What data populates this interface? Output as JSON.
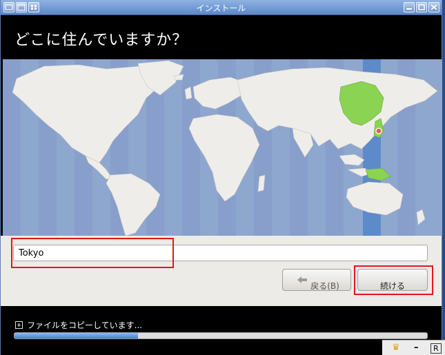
{
  "window": {
    "title": "インストール"
  },
  "header": {
    "question": "どこに住んでいますか？"
  },
  "timezone": {
    "selected_city": "Tokyo"
  },
  "buttons": {
    "back_label": "戻る(B)",
    "next_label": "続ける"
  },
  "footer": {
    "status_text": "ファイルをコピーしています...",
    "progress_percent": 30
  },
  "tray": {
    "items": [
      "crown-icon",
      "minimize-icon",
      "r-icon"
    ],
    "r_label": "R"
  },
  "colors": {
    "map_ocean": "#8ea7cf",
    "map_land": "#efedea",
    "timezone_band": "#5d8ac8",
    "selected_region": "#8bd353",
    "highlight": "#e6141b",
    "titlebar": "#6f95cc"
  }
}
